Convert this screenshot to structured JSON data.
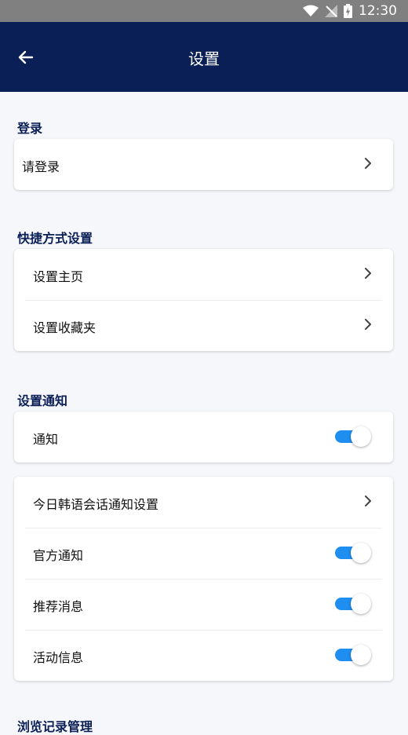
{
  "status_bar": {
    "time": "12:30"
  },
  "app_bar": {
    "title": "设置"
  },
  "sections": {
    "login": {
      "title": "登录",
      "items": [
        "请登录"
      ]
    },
    "shortcut": {
      "title": "快捷方式设置",
      "items": [
        "设置主页",
        "设置收藏夹"
      ]
    },
    "notifications": {
      "title": "设置通知",
      "master": {
        "label": "通知",
        "enabled": true
      },
      "items": [
        {
          "label": "今日韩语会话通知设置"
        },
        {
          "label": "官方通知",
          "enabled": true
        },
        {
          "label": "推荐消息",
          "enabled": true
        },
        {
          "label": "活动信息",
          "enabled": true
        }
      ]
    },
    "history": {
      "title": "浏览记录管理"
    }
  },
  "colors": {
    "primary": "#0b1f57",
    "toggle_on": "#1e8ef1"
  }
}
